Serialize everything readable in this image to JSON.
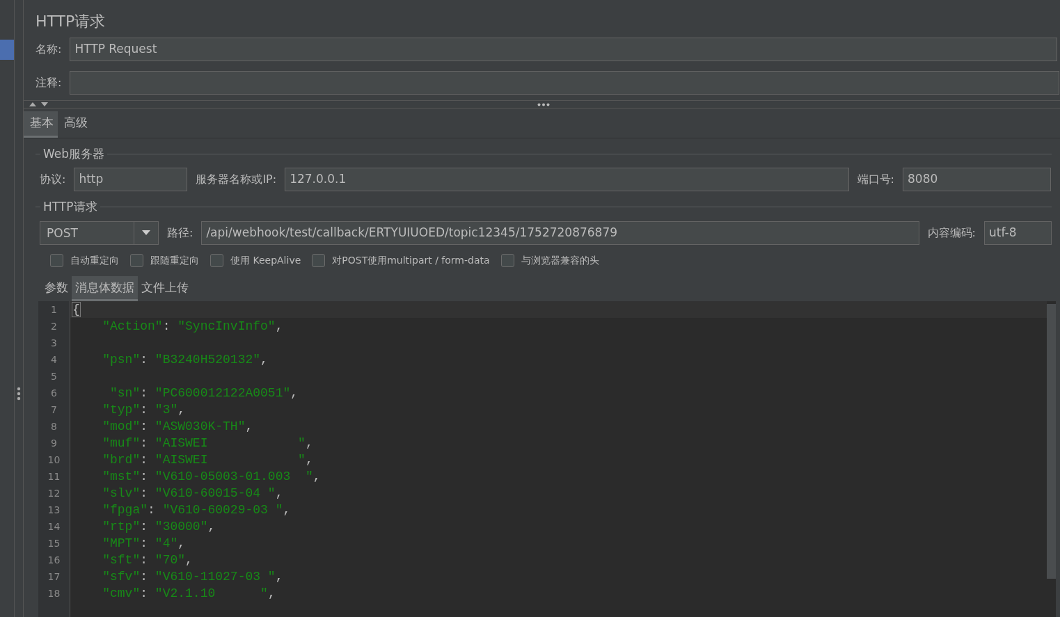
{
  "title": "HTTP请求",
  "name_field": {
    "label": "名称:",
    "value": "HTTP Request"
  },
  "comment_field": {
    "label": "注释:"
  },
  "tabs": [
    {
      "label": "基本",
      "selected": true
    },
    {
      "label": "高级",
      "selected": false
    }
  ],
  "web_server": {
    "legend": "Web服务器",
    "protocol": {
      "label": "协议:",
      "value": "http"
    },
    "server": {
      "label": "服务器名称或IP:",
      "value": "127.0.0.1"
    },
    "port": {
      "label": "端口号:",
      "value": "8080"
    }
  },
  "http_request": {
    "legend": "HTTP请求",
    "method": "POST",
    "path": {
      "label": "路径:",
      "value": "/api/webhook/test/callback/ERTYUIUOED/topic12345/1752720876879"
    },
    "encoding": {
      "label": "内容编码:",
      "value": "utf-8"
    }
  },
  "options": [
    {
      "label": "自动重定向",
      "checked": false
    },
    {
      "label": "跟随重定向",
      "checked": false
    },
    {
      "label": "使用 KeepAlive",
      "checked": false
    },
    {
      "label": "对POST使用multipart / form-data",
      "checked": false
    },
    {
      "label": "与浏览器兼容的头",
      "checked": false
    }
  ],
  "body_tabs": [
    {
      "label": "参数",
      "selected": false
    },
    {
      "label": "消息体数据",
      "selected": true
    },
    {
      "label": "文件上传",
      "selected": false
    }
  ],
  "code_lines": [
    {
      "number": "1",
      "text": "{"
    },
    {
      "number": "2",
      "text": "    \"Action\": \"SyncInvInfo\","
    },
    {
      "number": "3"
    },
    {
      "number": "4",
      "text": "    \"psn\": \"B3240H520132\","
    },
    {
      "number": "5"
    },
    {
      "number": "6",
      "text": "     \"sn\": \"PC600012122A0051\","
    },
    {
      "number": "7",
      "text": "    \"typ\": \"3\","
    },
    {
      "number": "8",
      "text": "    \"mod\": \"ASW030K-TH\","
    },
    {
      "number": "9",
      "text": "    \"muf\": \"AISWEI            \","
    },
    {
      "number": "10",
      "text": "    \"brd\": \"AISWEI            \","
    },
    {
      "number": "11",
      "text": "    \"mst\": \"V610-05003-01.003  \","
    },
    {
      "number": "12",
      "text": "    \"slv\": \"V610-60015-04 \","
    },
    {
      "number": "13",
      "text": "    \"fpga\": \"V610-60029-03 \","
    },
    {
      "number": "14",
      "text": "    \"rtp\": \"30000\","
    },
    {
      "number": "15",
      "text": "    \"MPT\": \"4\","
    },
    {
      "number": "16",
      "text": "    \"sft\": \"70\","
    },
    {
      "number": "17",
      "text": "    \"sfv\": \"V610-11027-03 \","
    },
    {
      "number": "18",
      "text": "    \"cmv\": \"V2.1.10      \","
    }
  ]
}
